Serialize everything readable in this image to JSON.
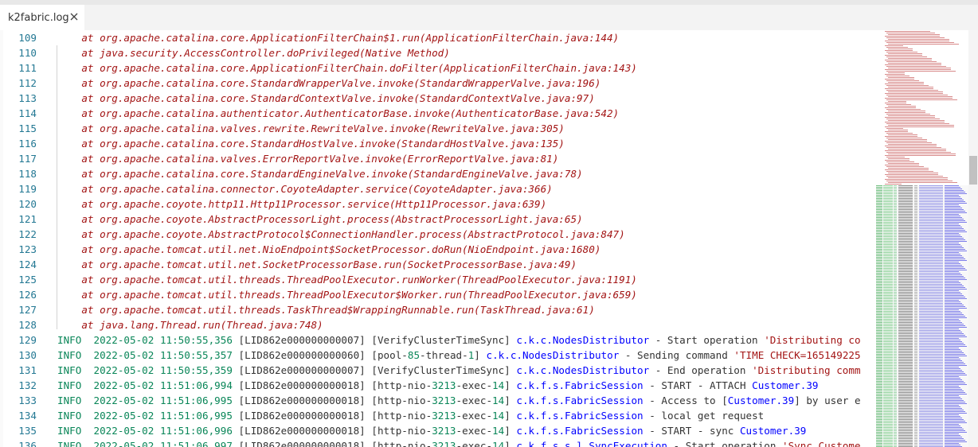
{
  "tab": {
    "title": "k2fabric.log",
    "close_icon": "close-icon"
  },
  "lines": [
    {
      "n": "109",
      "t": "trace",
      "text": "    at org.apache.catalina.core.ApplicationFilterChain$1.run(ApplicationFilterChain.java:144)"
    },
    {
      "n": "110",
      "t": "trace",
      "text": "    at java.security.AccessController.doPrivileged(Native Method)"
    },
    {
      "n": "111",
      "t": "trace",
      "text": "    at org.apache.catalina.core.ApplicationFilterChain.doFilter(ApplicationFilterChain.java:143)"
    },
    {
      "n": "112",
      "t": "trace",
      "text": "    at org.apache.catalina.core.StandardWrapperValve.invoke(StandardWrapperValve.java:196)"
    },
    {
      "n": "113",
      "t": "trace",
      "text": "    at org.apache.catalina.core.StandardContextValve.invoke(StandardContextValve.java:97)"
    },
    {
      "n": "114",
      "t": "trace",
      "text": "    at org.apache.catalina.authenticator.AuthenticatorBase.invoke(AuthenticatorBase.java:542)"
    },
    {
      "n": "115",
      "t": "trace",
      "text": "    at org.apache.catalina.valves.rewrite.RewriteValve.invoke(RewriteValve.java:305)"
    },
    {
      "n": "116",
      "t": "trace",
      "text": "    at org.apache.catalina.core.StandardHostValve.invoke(StandardHostValve.java:135)"
    },
    {
      "n": "117",
      "t": "trace",
      "text": "    at org.apache.catalina.valves.ErrorReportValve.invoke(ErrorReportValve.java:81)"
    },
    {
      "n": "118",
      "t": "trace",
      "text": "    at org.apache.catalina.core.StandardEngineValve.invoke(StandardEngineValve.java:78)"
    },
    {
      "n": "119",
      "t": "trace",
      "text": "    at org.apache.catalina.connector.CoyoteAdapter.service(CoyoteAdapter.java:366)"
    },
    {
      "n": "120",
      "t": "trace",
      "text": "    at org.apache.coyote.http11.Http11Processor.service(Http11Processor.java:639)"
    },
    {
      "n": "121",
      "t": "trace",
      "text": "    at org.apache.coyote.AbstractProcessorLight.process(AbstractProcessorLight.java:65)"
    },
    {
      "n": "122",
      "t": "trace",
      "text": "    at org.apache.coyote.AbstractProtocol$ConnectionHandler.process(AbstractProtocol.java:847)"
    },
    {
      "n": "123",
      "t": "trace",
      "text": "    at org.apache.tomcat.util.net.NioEndpoint$SocketProcessor.doRun(NioEndpoint.java:1680)"
    },
    {
      "n": "124",
      "t": "trace",
      "text": "    at org.apache.tomcat.util.net.SocketProcessorBase.run(SocketProcessorBase.java:49)"
    },
    {
      "n": "125",
      "t": "trace",
      "text": "    at org.apache.tomcat.util.threads.ThreadPoolExecutor.runWorker(ThreadPoolExecutor.java:1191)"
    },
    {
      "n": "126",
      "t": "trace",
      "text": "    at org.apache.tomcat.util.threads.ThreadPoolExecutor$Worker.run(ThreadPoolExecutor.java:659)"
    },
    {
      "n": "127",
      "t": "trace",
      "text": "    at org.apache.tomcat.util.threads.TaskThread$WrappingRunnable.run(TaskThread.java:61)"
    },
    {
      "n": "128",
      "t": "trace",
      "text": "    at java.lang.Thread.run(Thread.java:748)"
    },
    {
      "n": "129",
      "t": "log",
      "level": "INFO",
      "date": "2022-05-02",
      "time": "11:50:55,356",
      "id": "[LID862e000000000007]",
      "thread_pre": "[VerifyClusterTimeSync]",
      "thread_num": "",
      "thread_mid": "",
      "thread_post": "",
      "logger": "c.k.c.NodesDistributor",
      "msg_pre": " - Start operation ",
      "msg_hl": "",
      "msg_str": "'Distributing co",
      "msg_post": ""
    },
    {
      "n": "130",
      "t": "log",
      "level": "INFO",
      "date": "2022-05-02",
      "time": "11:50:55,357",
      "id": "[LID862e000000000060]",
      "thread_pre": "[pool-",
      "thread_num": "85",
      "thread_mid": "-thread-",
      "thread_num2": "1",
      "thread_post": "]",
      "logger": "c.k.c.NodesDistributor",
      "msg_pre": " - Sending command ",
      "msg_hl": "",
      "msg_str": "'TIME CHECK=165149225",
      "msg_post": ""
    },
    {
      "n": "131",
      "t": "log",
      "level": "INFO",
      "date": "2022-05-02",
      "time": "11:50:55,359",
      "id": "[LID862e000000000007]",
      "thread_pre": "[VerifyClusterTimeSync]",
      "thread_num": "",
      "thread_mid": "",
      "thread_post": "",
      "logger": "c.k.c.NodesDistributor",
      "msg_pre": " - End operation ",
      "msg_hl": "",
      "msg_str": "'Distributing comm",
      "msg_post": ""
    },
    {
      "n": "132",
      "t": "log",
      "level": "INFO",
      "date": "2022-05-02",
      "time": "11:51:06,994",
      "id": "[LID862e000000000018]",
      "thread_pre": "[http-nio-",
      "thread_num": "3213",
      "thread_mid": "-exec-",
      "thread_num2": "14",
      "thread_post": "]",
      "logger": "c.k.f.s.FabricSession",
      "msg_pre": " - START - ATTACH ",
      "msg_hl": "Customer.39",
      "msg_str": "",
      "msg_post": ""
    },
    {
      "n": "133",
      "t": "log",
      "level": "INFO",
      "date": "2022-05-02",
      "time": "11:51:06,995",
      "id": "[LID862e000000000018]",
      "thread_pre": "[http-nio-",
      "thread_num": "3213",
      "thread_mid": "-exec-",
      "thread_num2": "14",
      "thread_post": "]",
      "logger": "c.k.f.s.FabricSession",
      "msg_pre": " - Access to [",
      "msg_hl": "Customer.39",
      "msg_str": "",
      "msg_post": "] by user e"
    },
    {
      "n": "134",
      "t": "log",
      "level": "INFO",
      "date": "2022-05-02",
      "time": "11:51:06,995",
      "id": "[LID862e000000000018]",
      "thread_pre": "[http-nio-",
      "thread_num": "3213",
      "thread_mid": "-exec-",
      "thread_num2": "14",
      "thread_post": "]",
      "logger": "c.k.f.s.FabricSession",
      "msg_pre": " - local get request",
      "msg_hl": "",
      "msg_str": "",
      "msg_post": ""
    },
    {
      "n": "135",
      "t": "log",
      "level": "INFO",
      "date": "2022-05-02",
      "time": "11:51:06,996",
      "id": "[LID862e000000000018]",
      "thread_pre": "[http-nio-",
      "thread_num": "3213",
      "thread_mid": "-exec-",
      "thread_num2": "14",
      "thread_post": "]",
      "logger": "c.k.f.s.FabricSession",
      "msg_pre": " - START - sync ",
      "msg_hl": "Customer.39",
      "msg_str": "",
      "msg_post": ""
    },
    {
      "n": "136",
      "t": "log",
      "level": "INFO",
      "date": "2022-05-02",
      "time": "11:51:06,997",
      "id": "[LID862e000000000018]",
      "thread_pre": "[http-nio-",
      "thread_num": "3213",
      "thread_mid": "-exec-",
      "thread_num2": "14",
      "thread_post": "]",
      "logger": "c.k.f.s.s.l.SyncExecution",
      "msg_pre": " - Start operation ",
      "msg_hl": "",
      "msg_str": "'Sync Custome",
      "msg_post": ""
    }
  ],
  "colors": {
    "trace": "#a31515",
    "level": "#098658",
    "number": "#098658",
    "logger": "#0000ff",
    "string": "#a31515",
    "line_number": "#237893"
  }
}
